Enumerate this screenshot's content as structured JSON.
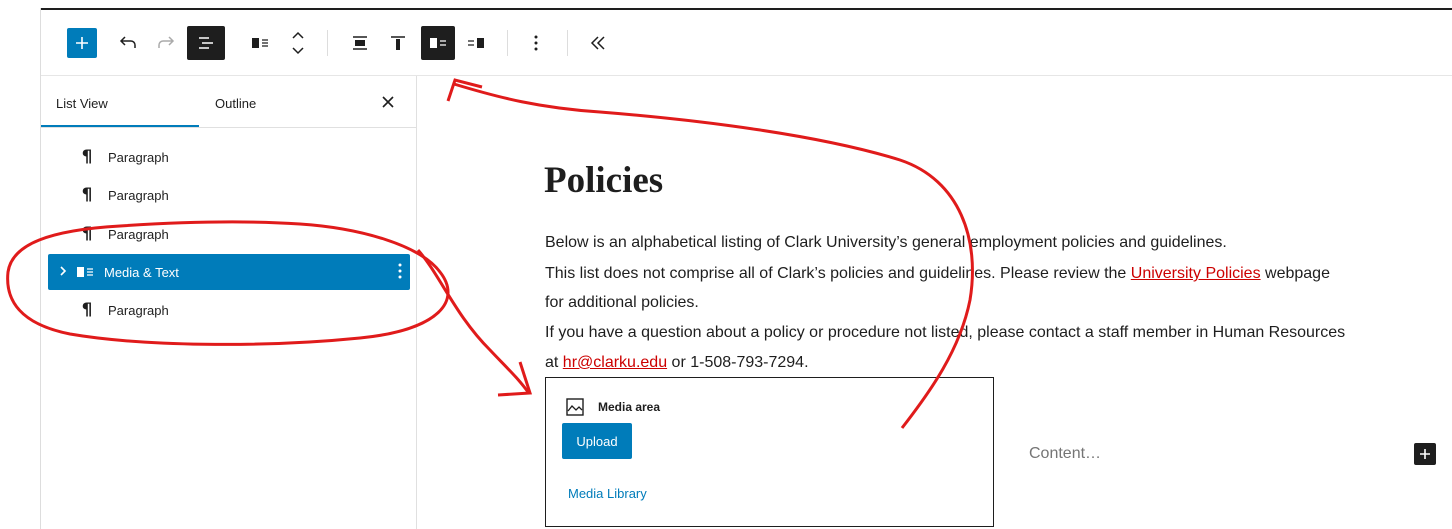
{
  "toolbar": {
    "add_icon": "plus-icon",
    "undo_icon": "undo-icon",
    "redo_icon": "redo-icon",
    "list_view_icon": "list-view-icon",
    "block_type_icon": "media-text-icon",
    "move_icon": "chevron-up-down-icon",
    "align_icons": [
      "align-wide-icon",
      "align-top-icon",
      "media-left-icon",
      "media-right-icon"
    ],
    "more_icon": "vertical-dots-icon",
    "collapse_icon": "double-chevron-left-icon"
  },
  "sidebar": {
    "tabs": [
      {
        "label": "List View"
      },
      {
        "label": "Outline"
      }
    ],
    "close_icon": "close-icon",
    "items": [
      {
        "label": "Paragraph"
      },
      {
        "label": "Paragraph"
      },
      {
        "label": "Paragraph"
      },
      {
        "label": "Media & Text"
      },
      {
        "label": "Paragraph"
      }
    ]
  },
  "content": {
    "title": "Policies",
    "line1": "Below is an alphabetical listing of Clark University’s general employment policies and guidelines.",
    "line2_before": "This list does not comprise all of Clark’s policies and guidelines. Please review the ",
    "line2_link": "University Policies",
    "line2_after": " webpage",
    "line3": "for additional policies.",
    "line4": "If you have a question about a policy or procedure not listed, please contact a staff member in Human Resources",
    "line5_before": "at ",
    "line5_link": "hr@clarku.edu",
    "line5_after": " or 1-508-793-7294.",
    "media": {
      "heading": "Media area",
      "upload": "Upload",
      "library": "Media Library"
    },
    "content_placeholder": "Content…"
  },
  "colors": {
    "accent": "#007cba",
    "annotation": "#e01b1b",
    "link": "#cc0000"
  }
}
